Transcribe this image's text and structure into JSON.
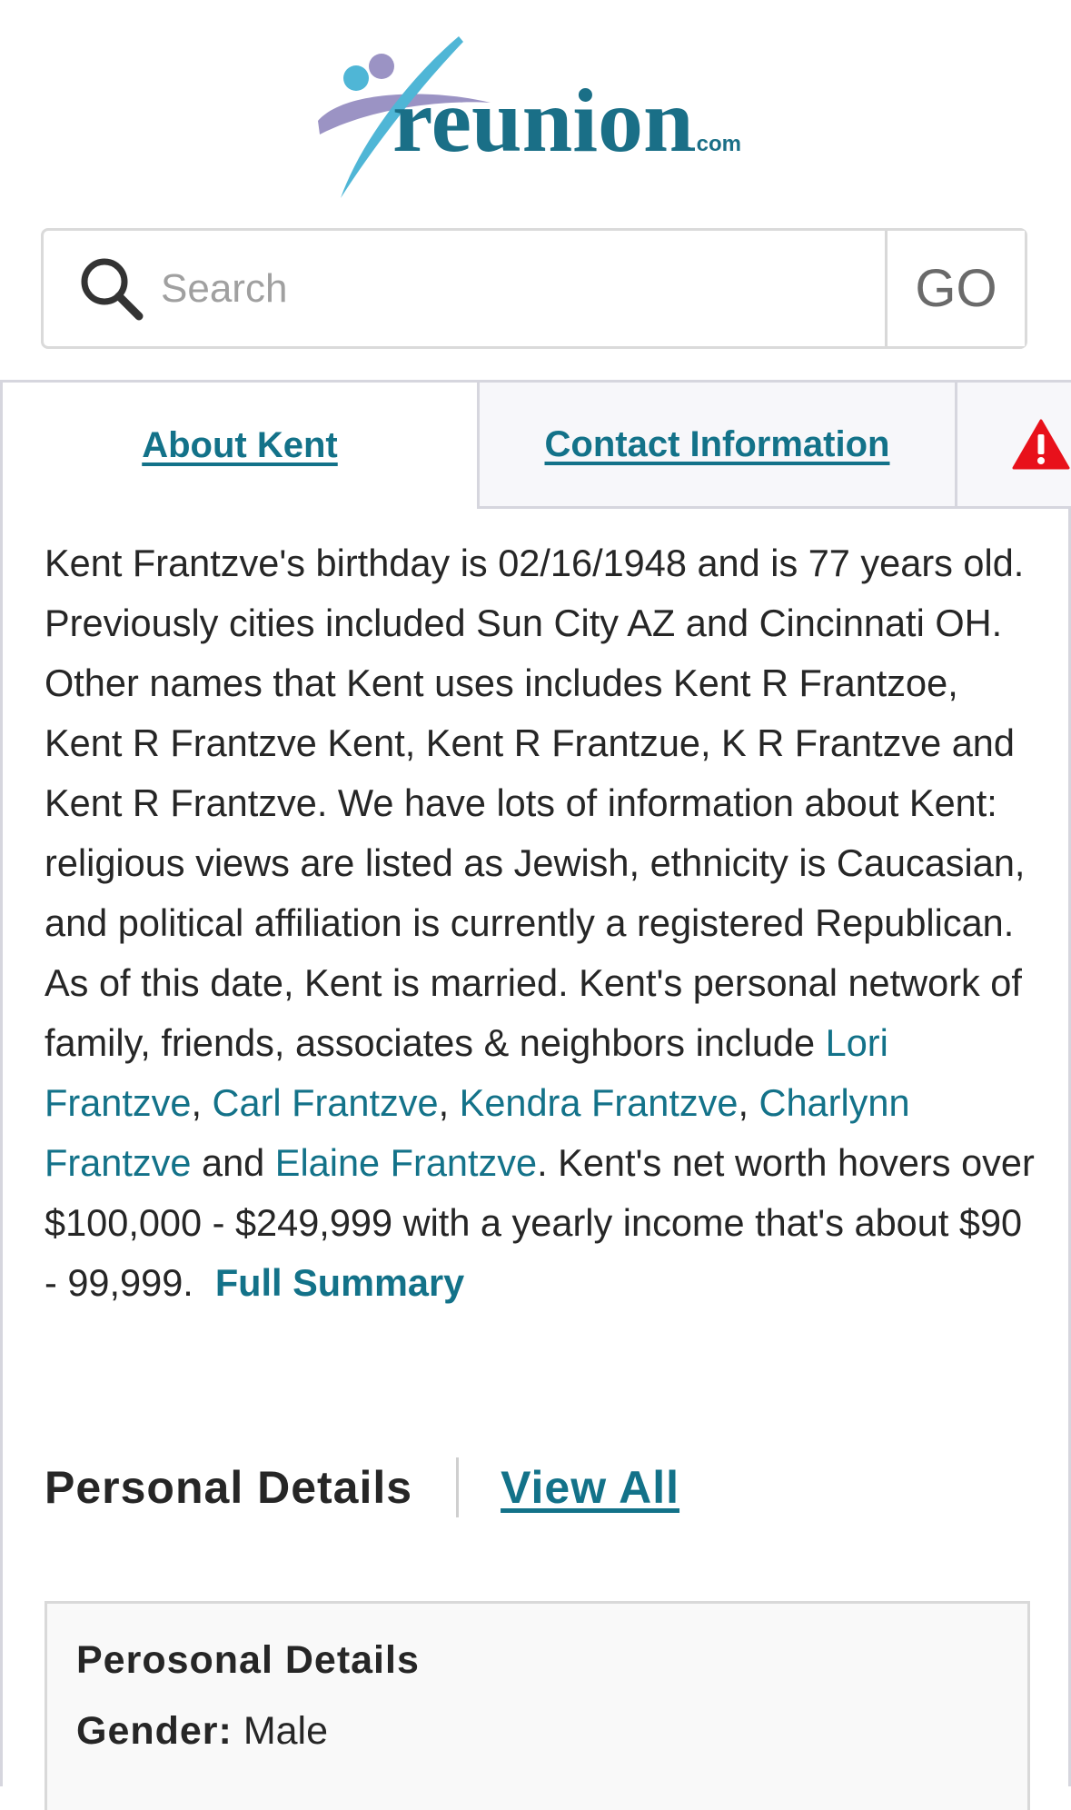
{
  "header": {
    "logo_text": "reunion",
    "logo_suffix": ".com"
  },
  "search": {
    "placeholder": "Search",
    "go_label": "GO"
  },
  "tabs": [
    {
      "label": "About Kent",
      "active": true
    },
    {
      "label": "Contact Information",
      "active": false
    },
    {
      "label": "",
      "icon": "warning-icon",
      "active": false
    }
  ],
  "summary": {
    "part1": "Kent Frantzve's birthday is 02/16/1948 and is 77 years old. Previously cities included Sun City AZ and Cincinnati OH. Other names that Kent uses includes Kent R Frantzoe, Kent R Frantzve Kent, Kent R Frantzue, K R Frantzve and Kent R Frantzve. We have lots of information about Kent: religious views are listed as Jewish, ethnicity is Caucasian, and political affiliation is currently a registered Republican. As of this date, Kent is married. Kent's personal network of family, friends, associates & neighbors include ",
    "links": [
      "Lori Frantzve",
      "Carl Frantzve",
      "Kendra Frantzve",
      "Charlynn Frantzve",
      "Elaine Frantzve"
    ],
    "sep_comma": ", ",
    "sep_and": " and ",
    "part2": ". Kent's net worth hovers over $100,000 - $249,999 with a yearly income that's about $90 - 99,999.",
    "full_summary_label": "Full Summary"
  },
  "personal_details": {
    "title": "Personal Details",
    "view_all_label": "View All",
    "card_title": "Perosonal Details",
    "gender_label": "Gender:",
    "gender_value": "Male"
  },
  "colors": {
    "link": "#137289",
    "text": "#262626",
    "warning": "#e8111b",
    "logo_teal": "#1a6f87",
    "logo_cyan": "#4fb6d6",
    "logo_purple": "#9b93c4"
  }
}
